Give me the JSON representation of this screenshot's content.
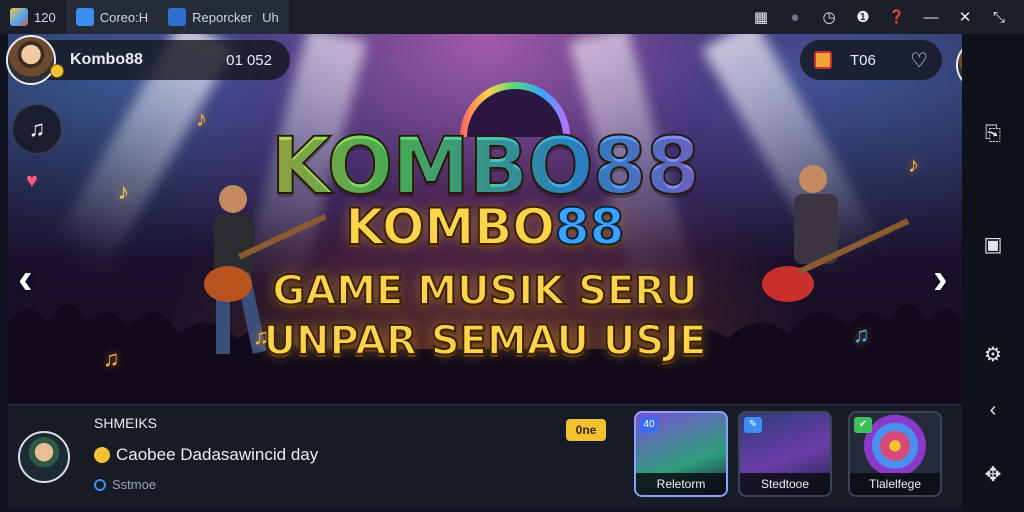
{
  "tabs": [
    {
      "label": "120",
      "icon": "app-cube-icon",
      "color": "#e9a93a"
    },
    {
      "label": "Coreo:H",
      "icon": "home-icon",
      "color": "#3a8ff0"
    },
    {
      "label": "Reporcker",
      "icon": "store-icon",
      "color": "#2f6fd1"
    },
    {
      "label": "Uh",
      "icon": "",
      "color": ""
    }
  ],
  "window_controls": {
    "qr": "▦",
    "record": "●",
    "clock": "◷",
    "info": "❶",
    "help": "❓",
    "minimize": "—",
    "close": "✕",
    "fullscreen": "⤡"
  },
  "header": {
    "username": "Kombo88",
    "score_label": "01 052",
    "coins_label": "T06",
    "coin_icon": "coin-icon",
    "heart_icon": "heart-icon"
  },
  "banner": {
    "logo": "KOMBO88",
    "line1_a": "KOMBO",
    "line1_b": "88",
    "line2": "GAME MUSIK SERU",
    "line3": "UNPAR SEMAU USJE"
  },
  "bottom": {
    "section_title": "SHMEIKS",
    "message": "Caobee Dadasawincid day",
    "sub_label": "Sstmoe",
    "tag": "0ne",
    "cards": [
      {
        "label": "Reletorm",
        "badge": "40",
        "badge_color": "#3a6df0"
      },
      {
        "label": "Stedtooe",
        "badge": "✎",
        "badge_color": "#3a8ff0"
      },
      {
        "label": "Tlalelfege",
        "badge": "✔",
        "badge_color": "#3cc15a"
      }
    ]
  },
  "colors": {
    "accent": "#ffd34a",
    "titlebar": "#1a1e29",
    "panel": "#161b26"
  }
}
